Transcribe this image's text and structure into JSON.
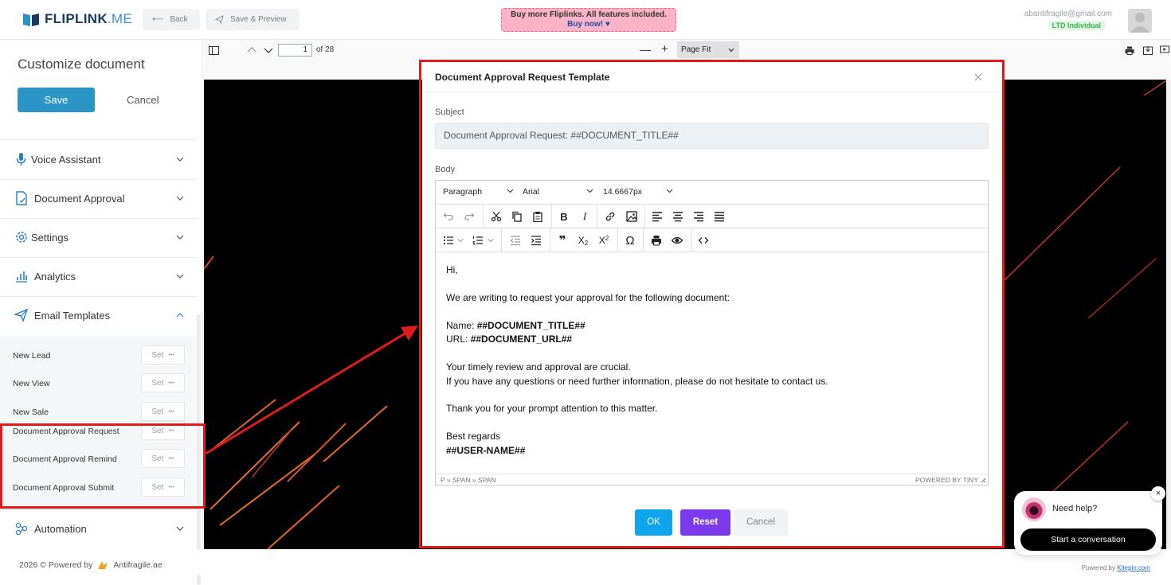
{
  "header": {
    "logo_main": "FLIPLINK",
    "logo_suffix": ".ME",
    "back_label": "Back",
    "save_preview_label": "Save & Preview",
    "promo_line1": "Buy more Fliplinks. All features included.",
    "promo_line2": "Buy now!",
    "promo_heart": "♥",
    "user_email": "abantifragile@gmail.com",
    "plan_badge": "LTD Individual"
  },
  "sidebar": {
    "title": "Customize document",
    "save_label": "Save",
    "cancel_label": "Cancel",
    "sections": [
      {
        "label": "Voice Assistant",
        "icon": "microphone-icon"
      },
      {
        "label": "Document Approval",
        "icon": "document-icon"
      },
      {
        "label": "Settings",
        "icon": "gear-icon"
      },
      {
        "label": "Analytics",
        "icon": "bar-chart-icon"
      },
      {
        "label": "Email Templates",
        "icon": "send-icon"
      },
      {
        "label": "Automation",
        "icon": "share-nodes-icon"
      }
    ],
    "templates": [
      {
        "name": "New Lead",
        "action": "Set"
      },
      {
        "name": "New View",
        "action": "Set"
      },
      {
        "name": "New Sale",
        "action": "Set"
      },
      {
        "name": "Document Approval Request",
        "action": "Set"
      },
      {
        "name": "Document Approval Remind",
        "action": "Set"
      },
      {
        "name": "Document Approval Submit",
        "action": "Set"
      }
    ],
    "more_glyph": "•••"
  },
  "pdf_viewer": {
    "page_current": "1",
    "page_total": "of 28",
    "zoom": "Page Fit"
  },
  "modal": {
    "title": "Document Approval Request Template",
    "subject_label": "Subject",
    "subject_value": "Document Approval Request: ##DOCUMENT_TITLE##",
    "body_label": "Body",
    "block_format": "Paragraph",
    "font_family": "Arial",
    "font_size": "14.6667px",
    "body": {
      "greeting": "Hi,",
      "intro": "We are writing to request your approval for the following document:",
      "name_label": "Name: ",
      "name_value": "##DOCUMENT_TITLE##",
      "url_label": "URL: ",
      "url_value": "##DOCUMENT_URL##",
      "line1": "Your timely review and approval are crucial.",
      "line2": "If you have any questions or need further information, please do not hesitate to contact us.",
      "thanks": "Thank you for your prompt attention to this matter.",
      "regards": "Best regards",
      "signature": "##USER-NAME##"
    },
    "status_path": "P » SPAN » SPAN",
    "powered_by": "POWERED BY TINY",
    "ok_label": "OK",
    "reset_label": "Reset",
    "cancel_label": "Cancel",
    "colors": {
      "ok": "#0ea5ec",
      "reset": "#7c3aed",
      "highlight": "#e01b1b"
    }
  },
  "footer": {
    "copyright": "2026 © Powered by",
    "brand": "Antifragile.ae",
    "kitepin_prefix": "Powered by ",
    "kitepin_link": "Kitepin.com"
  },
  "chat": {
    "help": "Need help?",
    "start": "Start a conversation",
    "close": "×"
  }
}
